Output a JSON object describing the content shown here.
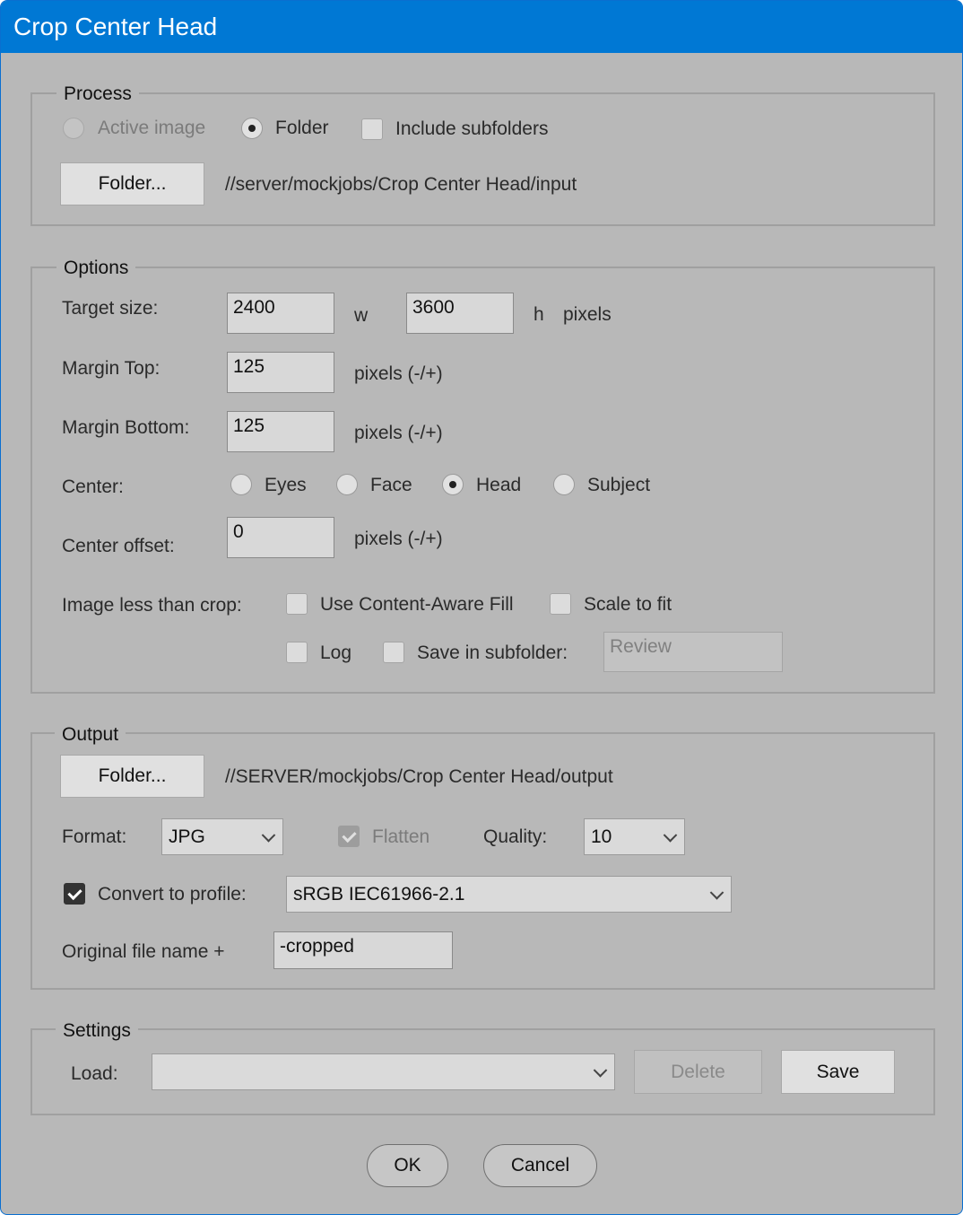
{
  "window": {
    "title": "Crop Center Head"
  },
  "process": {
    "label": "Process",
    "active_image": "Active image",
    "folder": "Folder",
    "include_subfolders": "Include subfolders",
    "folder_button": "Folder...",
    "input_path": "//server/mockjobs/Crop Center Head/input"
  },
  "options": {
    "label": "Options",
    "target_size_label": "Target size:",
    "width": "2400",
    "w_label": "w",
    "height": "3600",
    "h_label": "h",
    "pixels": "pixels",
    "margin_top_label": "Margin Top:",
    "margin_top": "125",
    "margin_bottom_label": "Margin Bottom:",
    "margin_bottom": "125",
    "pixels_pm": "pixels (-/+)",
    "center_label": "Center:",
    "center_options": [
      "Eyes",
      "Face",
      "Head",
      "Subject"
    ],
    "center_selected": "Head",
    "center_offset_label": "Center offset:",
    "center_offset": "0",
    "less_than_crop_label": "Image less than crop:",
    "content_aware": "Use Content-Aware Fill",
    "scale_to_fit": "Scale to fit",
    "log": "Log",
    "save_in_subfolder": "Save in subfolder:",
    "subfolder_value": "Review"
  },
  "output": {
    "label": "Output",
    "folder_button": "Folder...",
    "output_path": "//SERVER/mockjobs/Crop Center Head/output",
    "format_label": "Format:",
    "format_value": "JPG",
    "flatten": "Flatten",
    "quality_label": "Quality:",
    "quality_value": "10",
    "convert_label": "Convert to profile:",
    "profile_value": "sRGB IEC61966-2.1",
    "original_name_label": "Original file name +",
    "suffix_value": "-cropped"
  },
  "settings": {
    "label": "Settings",
    "load_label": "Load:",
    "load_value": "",
    "delete": "Delete",
    "save": "Save"
  },
  "footer": {
    "ok": "OK",
    "cancel": "Cancel"
  }
}
